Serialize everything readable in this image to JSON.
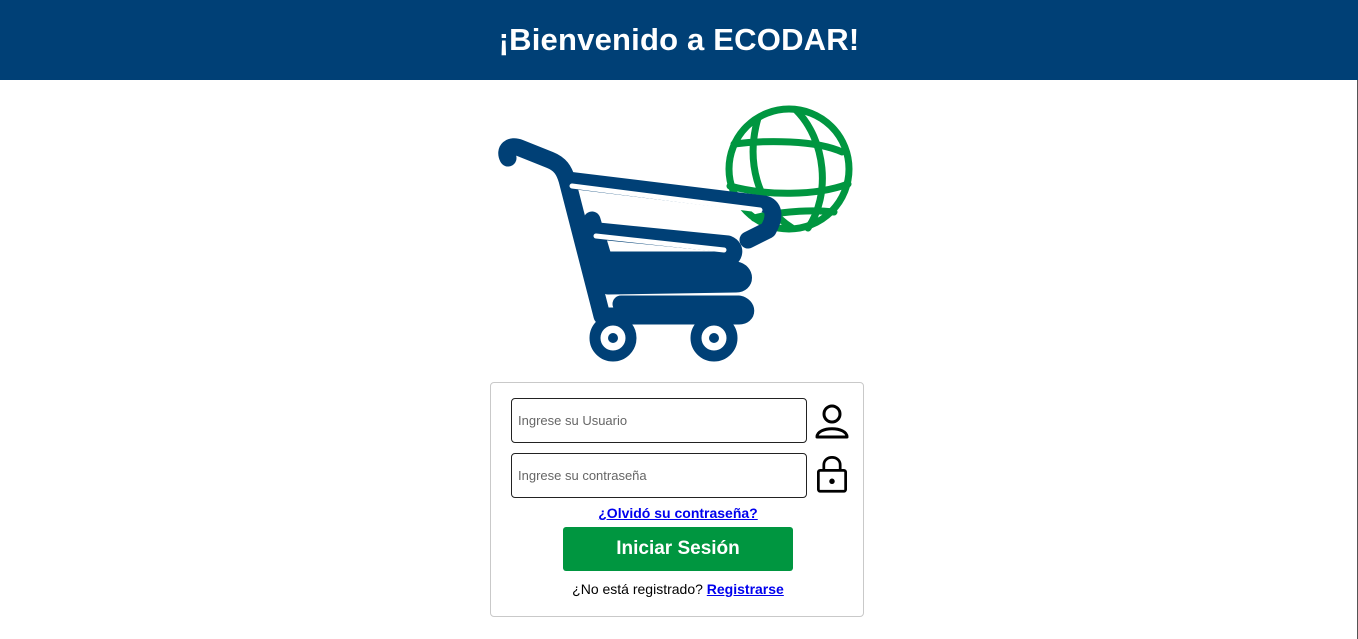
{
  "header": {
    "title": "¡Bienvenido a ECODAR!"
  },
  "logo": {
    "icon": "shopping-cart-globe-logo",
    "colors": {
      "cart": "#004076",
      "globe": "#009640"
    }
  },
  "login": {
    "username": {
      "placeholder": "Ingrese su Usuario",
      "value": "",
      "icon": "user-icon"
    },
    "password": {
      "placeholder": "Ingrese su contraseña",
      "value": "",
      "icon": "lock-icon"
    },
    "forgot_label": "¿Olvidó su contraseña?",
    "submit_label": "Iniciar Sesión",
    "register_prompt": "¿No está registrado?",
    "register_link": "Registrarse"
  },
  "colors": {
    "header_bg": "#004076",
    "primary_button": "#009640",
    "link": "#0000ee"
  }
}
